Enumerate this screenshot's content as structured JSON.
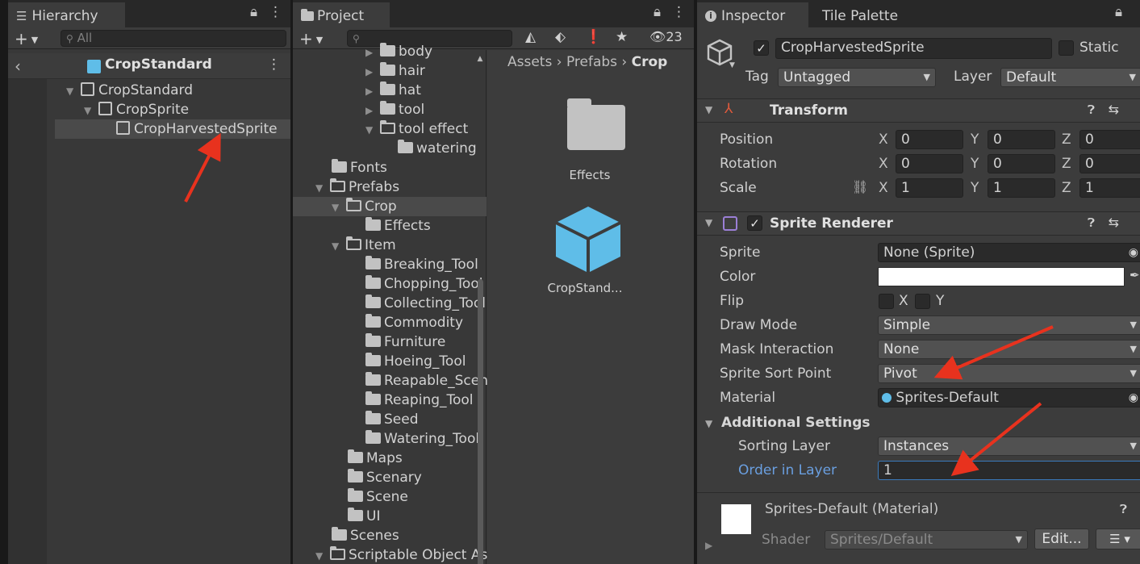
{
  "hierarchy": {
    "tab_label": "Hierarchy",
    "search_placeholder": "All",
    "scene_title": "CropStandard",
    "rows": [
      {
        "label": "CropStandard"
      },
      {
        "label": "CropSprite"
      },
      {
        "label": "CropHarvestedSprite"
      }
    ]
  },
  "project": {
    "tab_label": "Project",
    "hidden_count": "23",
    "breadcrumb": [
      "Assets",
      "Prefabs",
      "Crop"
    ],
    "tree": [
      {
        "label": "body"
      },
      {
        "label": "hair"
      },
      {
        "label": "hat"
      },
      {
        "label": "tool"
      },
      {
        "label": "tool effect"
      },
      {
        "label": "watering"
      },
      {
        "label": "Fonts"
      },
      {
        "label": "Prefabs"
      },
      {
        "label": "Crop"
      },
      {
        "label": "Effects"
      },
      {
        "label": "Item"
      },
      {
        "label": "Breaking_Tool"
      },
      {
        "label": "Chopping_Tool"
      },
      {
        "label": "Collecting_Tool"
      },
      {
        "label": "Commodity"
      },
      {
        "label": "Furniture"
      },
      {
        "label": "Hoeing_Tool"
      },
      {
        "label": "Reapable_Scenery"
      },
      {
        "label": "Reaping_Tool"
      },
      {
        "label": "Seed"
      },
      {
        "label": "Watering_Tool"
      },
      {
        "label": "Maps"
      },
      {
        "label": "Scenary"
      },
      {
        "label": "Scene"
      },
      {
        "label": "UI"
      },
      {
        "label": "Scenes"
      },
      {
        "label": "Scriptable Object Assets"
      }
    ],
    "assets": [
      {
        "label": "Effects"
      },
      {
        "label": "CropStand..."
      }
    ]
  },
  "inspector": {
    "tab_label": "Inspector",
    "tab2_label": "Tile Palette",
    "object_name": "CropHarvestedSprite",
    "static_label": "Static",
    "tag_label": "Tag",
    "tag_value": "Untagged",
    "layer_label": "Layer",
    "layer_value": "Default",
    "transform": {
      "title": "Transform",
      "position_label": "Position",
      "rotation_label": "Rotation",
      "scale_label": "Scale",
      "position": [
        "0",
        "0",
        "0"
      ],
      "rotation": [
        "0",
        "0",
        "0"
      ],
      "scale": [
        "1",
        "1",
        "1"
      ],
      "axes": [
        "X",
        "Y",
        "Z"
      ]
    },
    "sprite_renderer": {
      "title": "Sprite Renderer",
      "sprite_label": "Sprite",
      "sprite_value": "None (Sprite)",
      "color_label": "Color",
      "color_value": "#ffffff",
      "flip_label": "Flip",
      "flip_x": "X",
      "flip_y": "Y",
      "draw_mode_label": "Draw Mode",
      "draw_mode_value": "Simple",
      "mask_label": "Mask Interaction",
      "mask_value": "None",
      "sort_point_label": "Sprite Sort Point",
      "sort_point_value": "Pivot",
      "material_label": "Material",
      "material_value": "Sprites-Default",
      "additional_label": "Additional Settings",
      "sorting_layer_label": "Sorting Layer",
      "sorting_layer_value": "Instances",
      "order_label": "Order in Layer",
      "order_value": "1"
    },
    "material": {
      "title": "Sprites-Default (Material)",
      "shader_label": "Shader",
      "shader_value": "Sprites/Default",
      "edit_label": "Edit..."
    }
  },
  "colors": {
    "accent_arrow": "#e8321e",
    "link_blue": "#6a9fe0",
    "cube_blue": "#5fbde8"
  }
}
